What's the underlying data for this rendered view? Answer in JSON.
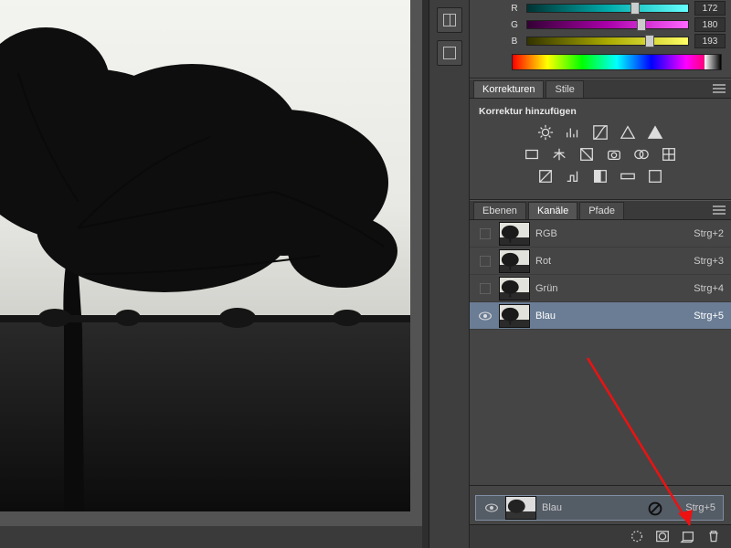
{
  "color": {
    "rows": [
      {
        "label": "R",
        "value": "172",
        "knob_pct": 67
      },
      {
        "label": "G",
        "value": "180",
        "knob_pct": 71
      },
      {
        "label": "B",
        "value": "193",
        "knob_pct": 76
      }
    ]
  },
  "adjustments": {
    "tabs": [
      {
        "label": "Korrekturen",
        "active": true
      },
      {
        "label": "Stile",
        "active": false
      }
    ],
    "subtitle": "Korrektur hinzufügen",
    "icons_row1": [
      "brightness",
      "levels",
      "curves",
      "exposure-triangle",
      "filled-triangle"
    ],
    "icons_row2": [
      "vibrance",
      "balance",
      "bw",
      "photo-filter",
      "channel-mixer",
      "color-lookup"
    ],
    "icons_row3": [
      "invert",
      "posterize",
      "threshold",
      "gradient-map",
      "selective-color"
    ]
  },
  "channels": {
    "tabs": [
      {
        "label": "Ebenen",
        "active": false
      },
      {
        "label": "Kanäle",
        "active": true
      },
      {
        "label": "Pfade",
        "active": false
      }
    ],
    "rows": [
      {
        "visible": false,
        "name": "RGB",
        "shortcut": "Strg+2",
        "thumb_tint": "#777",
        "selected": false
      },
      {
        "visible": false,
        "name": "Rot",
        "shortcut": "Strg+3",
        "thumb_tint": "#888",
        "selected": false
      },
      {
        "visible": false,
        "name": "Grün",
        "shortcut": "Strg+4",
        "thumb_tint": "#888",
        "selected": false
      },
      {
        "visible": true,
        "name": "Blau",
        "shortcut": "Strg+5",
        "thumb_tint": "#888",
        "selected": true
      }
    ],
    "drag_ghost": {
      "name": "Blau",
      "shortcut": "Strg+5"
    },
    "footer_icons": [
      "selection-to-channel",
      "mask",
      "new-channel",
      "trash"
    ]
  }
}
